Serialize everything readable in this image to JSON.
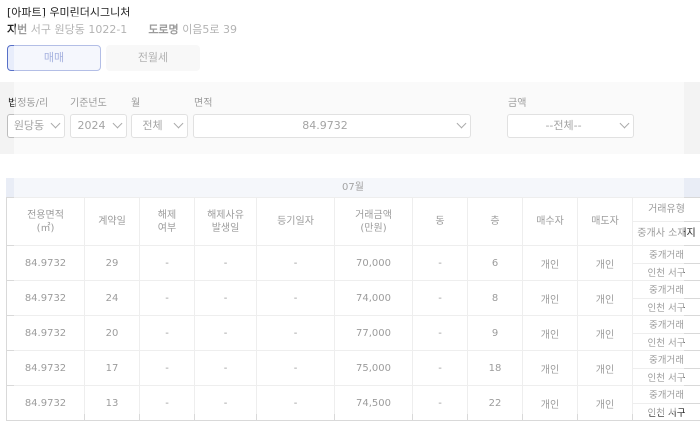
{
  "header": {
    "title": "[아파트] 우미린더시그니처",
    "jibun_label": "지번",
    "jibun_value": "서구 원당동 1022-1",
    "road_label": "도로명",
    "road_value": "이음5로 39"
  },
  "tabs": [
    {
      "label": "매매",
      "active": true
    },
    {
      "label": "전월세",
      "active": false
    }
  ],
  "filters": {
    "dong_label": "법정동/리",
    "dong_value": "원당동",
    "year_label": "기준년도",
    "year_value": "2024",
    "month_label": "월",
    "month_value": "전체",
    "area_label": "면적",
    "area_value": "84.9732",
    "price_label": "금액",
    "price_value": "--전체--"
  },
  "month_header": "07월",
  "columns": {
    "area": "전용면적\n(㎡)",
    "contract_day": "계약일",
    "cancel": "해제\n여부",
    "cancel_date": "해제사유\n발생일",
    "reg_date": "등기일자",
    "price": "거래금액\n(만원)",
    "building": "동",
    "floor": "층",
    "buyer": "매수자",
    "seller": "매도자",
    "trade_type": "거래유형",
    "broker_loc": "중개사 소재지"
  },
  "rows": [
    {
      "area": "84.9732",
      "day": "29",
      "cancel": "-",
      "cancel_date": "-",
      "reg": "-",
      "price": "70,000",
      "dong": "-",
      "floor": "6",
      "buyer": "개인",
      "seller": "개인",
      "type": "중개거래",
      "loc": "인천 서구"
    },
    {
      "area": "84.9732",
      "day": "24",
      "cancel": "-",
      "cancel_date": "-",
      "reg": "-",
      "price": "74,000",
      "dong": "-",
      "floor": "8",
      "buyer": "개인",
      "seller": "개인",
      "type": "중개거래",
      "loc": "인천 서구"
    },
    {
      "area": "84.9732",
      "day": "20",
      "cancel": "-",
      "cancel_date": "-",
      "reg": "-",
      "price": "77,000",
      "dong": "-",
      "floor": "9",
      "buyer": "개인",
      "seller": "개인",
      "type": "중개거래",
      "loc": "인천 서구"
    },
    {
      "area": "84.9732",
      "day": "17",
      "cancel": "-",
      "cancel_date": "-",
      "reg": "-",
      "price": "75,000",
      "dong": "-",
      "floor": "18",
      "buyer": "개인",
      "seller": "개인",
      "type": "중개거래",
      "loc": "인천 서구"
    },
    {
      "area": "84.9732",
      "day": "13",
      "cancel": "-",
      "cancel_date": "-",
      "reg": "-",
      "price": "74,500",
      "dong": "-",
      "floor": "22",
      "buyer": "개인",
      "seller": "개인",
      "type": "중개거래",
      "loc": "인천 서구"
    }
  ],
  "colors": {
    "accent": "#5770c8",
    "tab_active_bg": "#e8edfb",
    "filter_bg": "#f3f3f3",
    "month_band_bg": "#e9edf6"
  }
}
